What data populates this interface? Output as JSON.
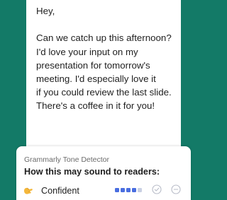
{
  "email": {
    "greeting": "Hey,",
    "lines": [
      "Can we catch up this afternoon?",
      "I'd love your input on my",
      "presentation for tomorrow's",
      "meeting. I'd especially love it",
      "if you could review the last slide.",
      "There's a coffee in it for you!"
    ]
  },
  "tone_detector": {
    "caption": "Grammarly Tone Detector",
    "heading": "How this may sound to readers:",
    "tones": [
      {
        "label": "Confident",
        "emoji_icon": "confident-face-icon",
        "intensity": 4,
        "intensity_max": 5
      }
    ]
  },
  "colors": {
    "background": "#137a67",
    "intensity_active": "#4a6ee0",
    "intensity_inactive": "#c9d0e3"
  }
}
